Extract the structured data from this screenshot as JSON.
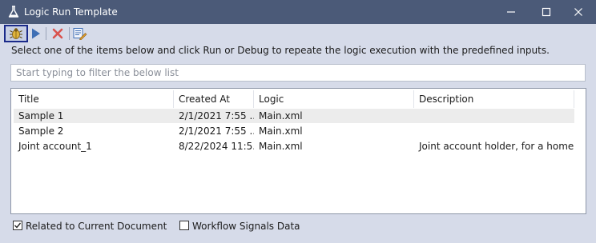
{
  "window": {
    "title": "Logic Run Template",
    "icon": "flask-icon"
  },
  "toolbar": {
    "debug_icon": "bug-icon",
    "run_icon": "play-icon",
    "delete_icon": "delete-x-icon",
    "edit_icon": "edit-list-icon"
  },
  "instruction": "Select one of the items below and click Run or Debug to repeate the logic execution with the predefined inputs.",
  "filter": {
    "placeholder": "Start typing to filter the below list",
    "value": ""
  },
  "table": {
    "columns": [
      "Title",
      "Created At",
      "Logic",
      "Description"
    ],
    "rows": [
      {
        "title": "Sample 1",
        "created_at": "2/1/2021 7:55 ...",
        "logic": "Main.xml",
        "description": ""
      },
      {
        "title": "Sample 2",
        "created_at": "2/1/2021 7:55 ...",
        "logic": "Main.xml",
        "description": ""
      },
      {
        "title": "Joint account_1",
        "created_at": "8/22/2024 11:5...",
        "logic": "Main.xml",
        "description": "Joint account holder, for a home t..."
      }
    ]
  },
  "options": {
    "related": {
      "label": "Related to Current Document",
      "checked": true
    },
    "signals": {
      "label": "Workflow Signals Data",
      "checked": false
    }
  },
  "colors": {
    "titlebar": "#4b5a78",
    "window_bg": "#d6dbe9",
    "row_alt": "#ececec",
    "delete": "#d9534f",
    "run": "#3f6fb5"
  }
}
